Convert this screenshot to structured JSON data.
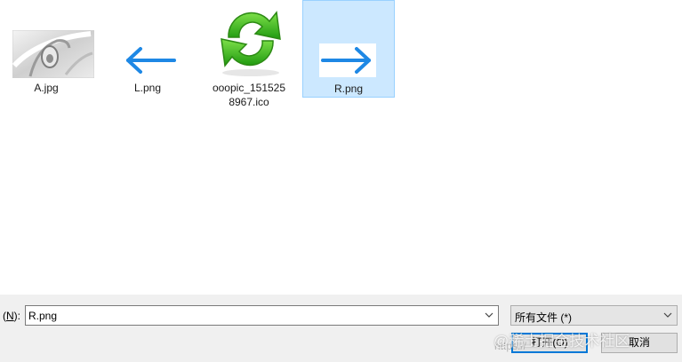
{
  "files": [
    {
      "name": "A.jpg",
      "icon": "image-thumbnail-icon",
      "selected": false
    },
    {
      "name": "L.png",
      "icon": "left-arrow-icon",
      "selected": false
    },
    {
      "name": "ooopic_1515258967.ico",
      "name_line1": "ooopic_151525",
      "name_line2": "8967.ico",
      "icon": "green-refresh-icon",
      "selected": true
    },
    {
      "name": "R.png",
      "icon": "right-arrow-icon",
      "selected": true
    }
  ],
  "filename": {
    "label_prefix": "(",
    "label_key": "N",
    "label_suffix": "):",
    "value": "R.png"
  },
  "filetype": {
    "value": "所有文件 (*)"
  },
  "buttons": {
    "open_label": "打开(O)",
    "cancel_label": "取消"
  },
  "watermark": {
    "text": "@稀土掘金技术社区",
    "small_text": "https://"
  },
  "colors": {
    "selection_fill": "#cce8ff",
    "selection_border": "#99d1ff",
    "arrow_blue": "#1e88e5",
    "refresh_green": "#3cb81c",
    "dialog_bg": "#f0f0f0"
  }
}
